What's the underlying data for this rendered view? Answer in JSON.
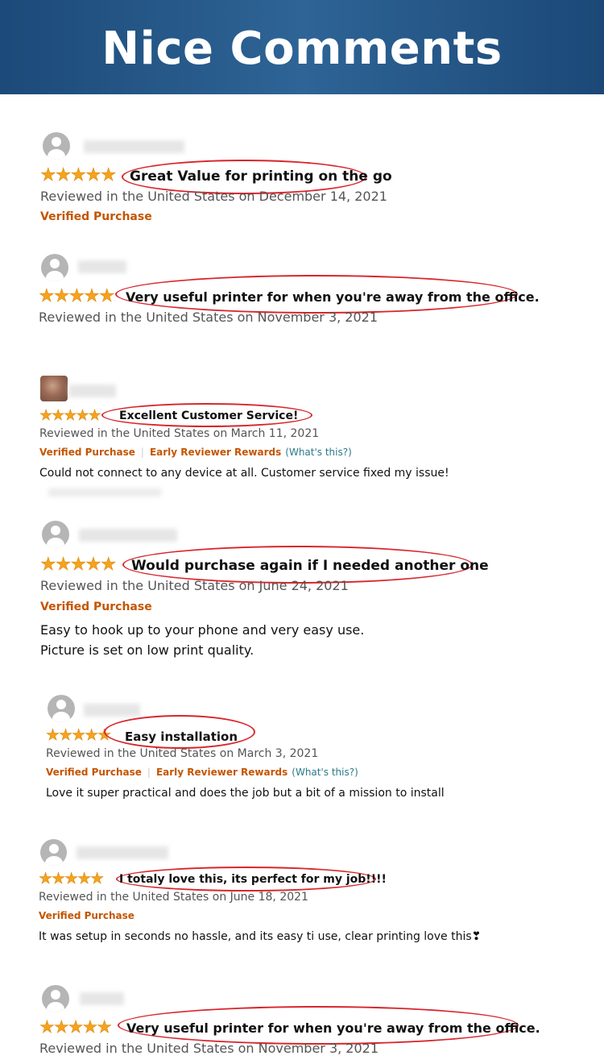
{
  "header": {
    "title": "Nice Comments"
  },
  "stars_glyph": "★★★★★",
  "reviews": [
    {
      "title": "Great Value for printing on the go",
      "meta": "Reviewed in the United States on December 14, 2021",
      "verified": "Verified Purchase"
    },
    {
      "title": "Very useful printer for when you're away from the office.",
      "meta": "Reviewed in the United States on November 3, 2021"
    },
    {
      "title": "Excellent Customer Service!",
      "meta": "Reviewed in the United States on March 11, 2021",
      "verified": "Verified Purchase",
      "early_reviewer": "Early Reviewer Rewards",
      "whats_this": "(What's this?)",
      "body": "Could not connect to any device at all. Customer service fixed my issue!"
    },
    {
      "title": "Would purchase again if I needed another one",
      "meta": "Reviewed in the United States on June 24, 2021",
      "verified": "Verified Purchase",
      "body_lines": [
        "Easy to hook up to your phone and very easy use.",
        "Picture is set on low print quality."
      ]
    },
    {
      "title": "Easy installation",
      "meta": "Reviewed in the United States on March 3, 2021",
      "verified": "Verified Purchase",
      "early_reviewer": "Early Reviewer Rewards",
      "whats_this": "(What's this?)",
      "body": "Love it super practical and does the job but a bit of a mission to install"
    },
    {
      "title": "I totaly love this, its perfect for my job!!!!",
      "meta": "Reviewed in the United States on June 18, 2021",
      "verified": "Verified Purchase",
      "body": "It was setup in seconds no hassle, and its easy ti use, clear printing love this❣"
    },
    {
      "title": "Very useful printer for when you're away from the office.",
      "meta": "Reviewed in the United States on November 3, 2021"
    }
  ]
}
